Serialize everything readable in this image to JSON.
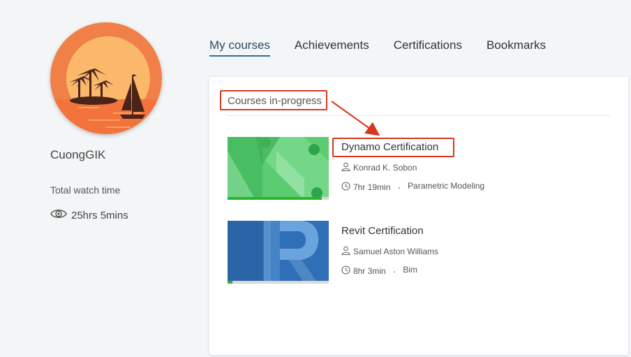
{
  "profile": {
    "username": "CuongGIK",
    "watch_time_label": "Total watch time",
    "watch_time_value": "25hrs 5mins",
    "watch_icon": "eye-icon"
  },
  "tabs": [
    {
      "label": "My courses",
      "active": true
    },
    {
      "label": "Achievements",
      "active": false
    },
    {
      "label": "Certifications",
      "active": false
    },
    {
      "label": "Bookmarks",
      "active": false
    }
  ],
  "section": {
    "title": "Courses in-progress"
  },
  "courses": [
    {
      "title": "Dynamo Certification",
      "author": "Konrad K. Sobon",
      "duration": "7hr 19min",
      "category": "Parametric Modeling",
      "progress": 0.93
    },
    {
      "title": "Revit Certification",
      "author": "Samuel Aston Williams",
      "duration": "8hr 3min",
      "category": "Bim",
      "progress": 0.05
    }
  ],
  "colors": {
    "accent": "#2d6f9c",
    "highlight": "#d9361c",
    "progress": "#2bb52e",
    "dynamo_green": "#5ccc73",
    "revit_blue": "#2f6fb8"
  }
}
